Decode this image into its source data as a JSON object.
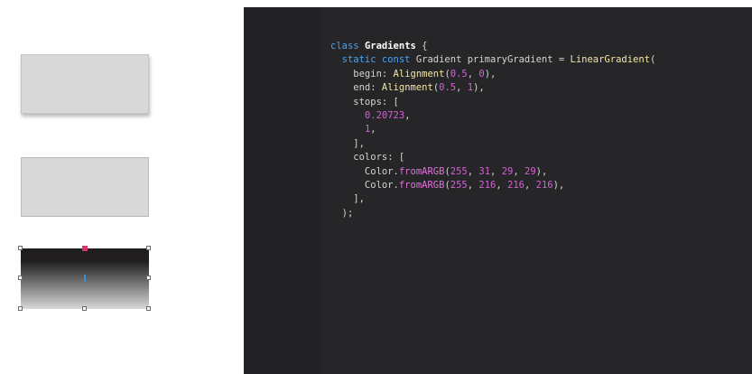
{
  "canvas": {
    "shapes": [
      {
        "name": "gray rectangle with shadow"
      },
      {
        "name": "gray rectangle"
      },
      {
        "name": "gradient rectangle (selected)"
      }
    ],
    "colors": {
      "dark": "#1f1d1d",
      "light": "#d8d8d8",
      "stop_marker": "#d6336c",
      "guide": "#3b8de0"
    }
  },
  "editor": {
    "code_lines": [
      [
        {
          "t": "class ",
          "c": "kw"
        },
        {
          "t": "Gradients",
          "c": "cls"
        },
        {
          "t": " {",
          "c": "plain"
        }
      ],
      [
        {
          "t": "  static const ",
          "c": "kw"
        },
        {
          "t": "Gradient primaryGradient = ",
          "c": "plain"
        },
        {
          "t": "LinearGradient",
          "c": "fn"
        },
        {
          "t": "(",
          "c": "plain"
        }
      ],
      [
        {
          "t": "    begin: ",
          "c": "plain"
        },
        {
          "t": "Alignment",
          "c": "fn"
        },
        {
          "t": "(",
          "c": "plain"
        },
        {
          "t": "0.5",
          "c": "num"
        },
        {
          "t": ", ",
          "c": "plain"
        },
        {
          "t": "0",
          "c": "num"
        },
        {
          "t": "),",
          "c": "plain"
        }
      ],
      [
        {
          "t": "    end: ",
          "c": "plain"
        },
        {
          "t": "Alignment",
          "c": "fn"
        },
        {
          "t": "(",
          "c": "plain"
        },
        {
          "t": "0.5",
          "c": "num"
        },
        {
          "t": ", ",
          "c": "plain"
        },
        {
          "t": "1",
          "c": "num"
        },
        {
          "t": "),",
          "c": "plain"
        }
      ],
      [
        {
          "t": "    stops: [",
          "c": "plain"
        }
      ],
      [
        {
          "t": "      ",
          "c": "plain"
        },
        {
          "t": "0.20723",
          "c": "num"
        },
        {
          "t": ",",
          "c": "plain"
        }
      ],
      [
        {
          "t": "      ",
          "c": "plain"
        },
        {
          "t": "1",
          "c": "num"
        },
        {
          "t": ",",
          "c": "plain"
        }
      ],
      [
        {
          "t": "    ],",
          "c": "plain"
        }
      ],
      [
        {
          "t": "    colors: [",
          "c": "plain"
        }
      ],
      [
        {
          "t": "      Color.",
          "c": "plain"
        },
        {
          "t": "fromARGB",
          "c": "pink"
        },
        {
          "t": "(",
          "c": "plain"
        },
        {
          "t": "255",
          "c": "num"
        },
        {
          "t": ", ",
          "c": "plain"
        },
        {
          "t": "31",
          "c": "num"
        },
        {
          "t": ", ",
          "c": "plain"
        },
        {
          "t": "29",
          "c": "num"
        },
        {
          "t": ", ",
          "c": "plain"
        },
        {
          "t": "29",
          "c": "num"
        },
        {
          "t": "),",
          "c": "plain"
        }
      ],
      [
        {
          "t": "      Color.",
          "c": "plain"
        },
        {
          "t": "fromARGB",
          "c": "pink"
        },
        {
          "t": "(",
          "c": "plain"
        },
        {
          "t": "255",
          "c": "num"
        },
        {
          "t": ", ",
          "c": "plain"
        },
        {
          "t": "216",
          "c": "num"
        },
        {
          "t": ", ",
          "c": "plain"
        },
        {
          "t": "216",
          "c": "num"
        },
        {
          "t": ", ",
          "c": "plain"
        },
        {
          "t": "216",
          "c": "num"
        },
        {
          "t": "),",
          "c": "plain"
        }
      ],
      [
        {
          "t": "    ],",
          "c": "plain"
        }
      ],
      [
        {
          "t": "  );",
          "c": "plain"
        }
      ]
    ]
  }
}
